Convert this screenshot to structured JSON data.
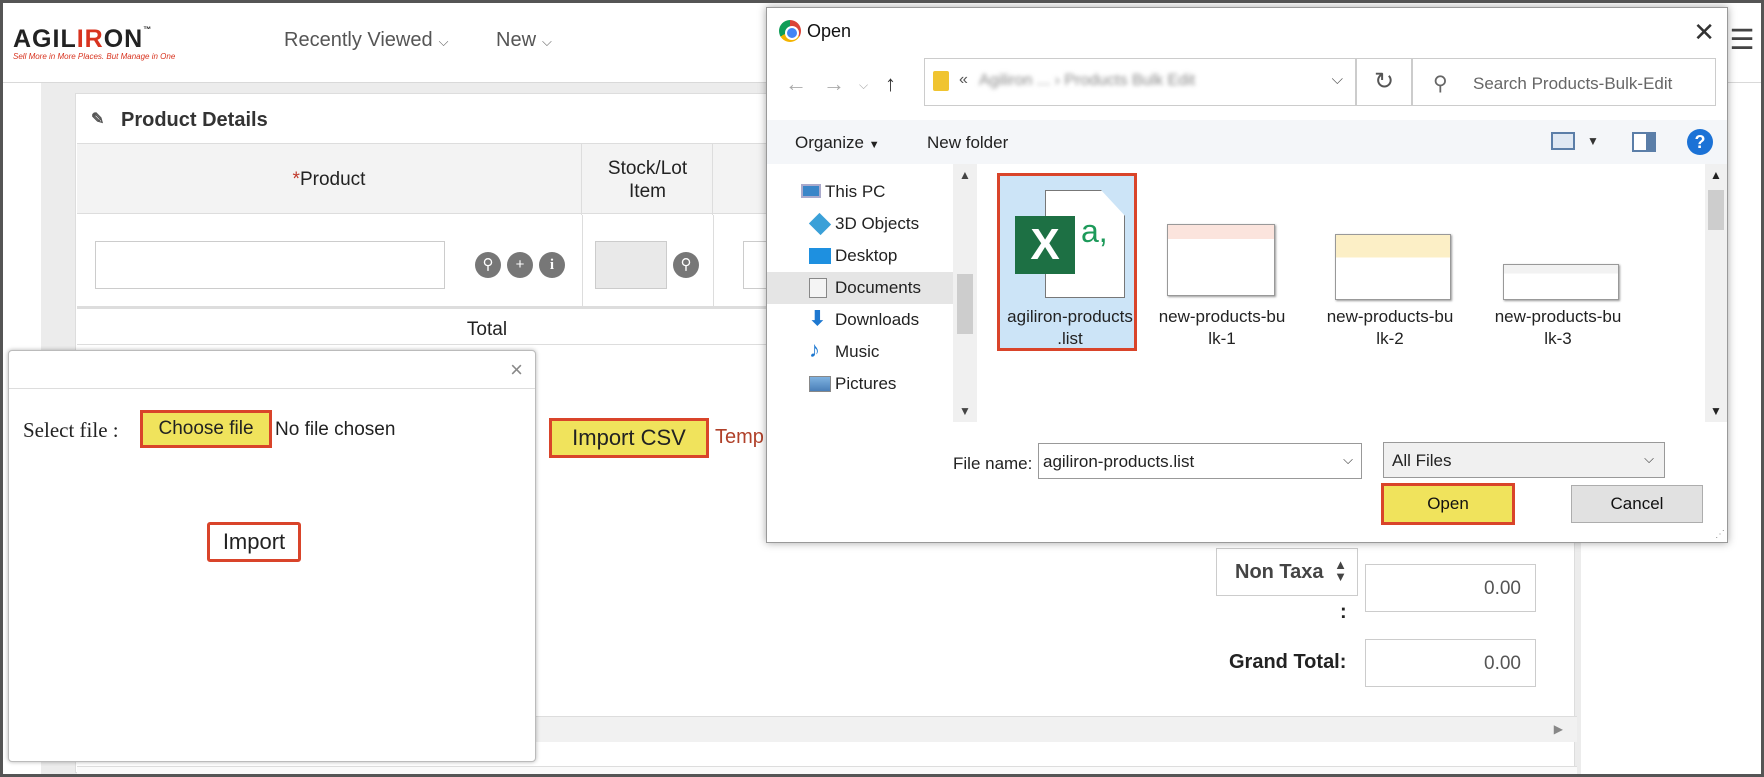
{
  "app": {
    "logo_text": "AGILIRON",
    "tagline": "Sell More in More Places. But Manage in One",
    "nav": [
      {
        "label": "Recently Viewed"
      },
      {
        "label": "New"
      }
    ]
  },
  "product_details": {
    "title": "Product Details",
    "col_product_required": "*",
    "col_product": "Product",
    "col_stock": "Stock/Lot Item",
    "total_label": "Total",
    "import_csv_label": "Import CSV",
    "template_link": "Temp",
    "tax_select_value": "Non Taxa",
    "tax_colon": ":",
    "tax_value": "0.00",
    "grand_total_label": "Grand Total:",
    "grand_total_value": "0.00"
  },
  "import_modal": {
    "close_label": "×",
    "select_file_label": "Select file :",
    "choose_file_label": "Choose file",
    "file_status": "No file chosen",
    "import_label": "Import"
  },
  "open_dialog": {
    "title": "Open",
    "address_prefix": "«",
    "address_path": "Agiliron ... › Products Bulk Edit",
    "search_placeholder": "Search Products-Bulk-Edit",
    "organize_label": "Organize",
    "new_folder_label": "New folder",
    "nav_items": [
      {
        "label": "This PC",
        "icon": "computer-icon"
      },
      {
        "label": "3D Objects",
        "icon": "cube-icon"
      },
      {
        "label": "Desktop",
        "icon": "desktop-icon"
      },
      {
        "label": "Documents",
        "icon": "documents-icon"
      },
      {
        "label": "Downloads",
        "icon": "download-arrow-icon"
      },
      {
        "label": "Music",
        "icon": "music-note-icon"
      },
      {
        "label": "Pictures",
        "icon": "pictures-icon"
      }
    ],
    "files": [
      {
        "name": "agiliron-products .list",
        "selected": true,
        "icon": "excel-csv-icon"
      },
      {
        "name": "new-products-bu lk-1",
        "selected": false,
        "icon": "spreadsheet-thumbnail"
      },
      {
        "name": "new-products-bu lk-2",
        "selected": false,
        "icon": "spreadsheet-thumbnail"
      },
      {
        "name": "new-products-bu lk-3",
        "selected": false,
        "icon": "spreadsheet-thumbnail"
      }
    ],
    "file_name_label": "File name:",
    "file_name_value": "agiliron-products.list",
    "file_type_value": "All Files",
    "open_label": "Open",
    "cancel_label": "Cancel",
    "excel_letter": "X",
    "excel_sub": "a,"
  },
  "colors": {
    "highlight": "#f0e35c",
    "annotation_border": "#d9442a",
    "brand_red": "#d8331f",
    "selection_blue": "#cce4f7"
  }
}
